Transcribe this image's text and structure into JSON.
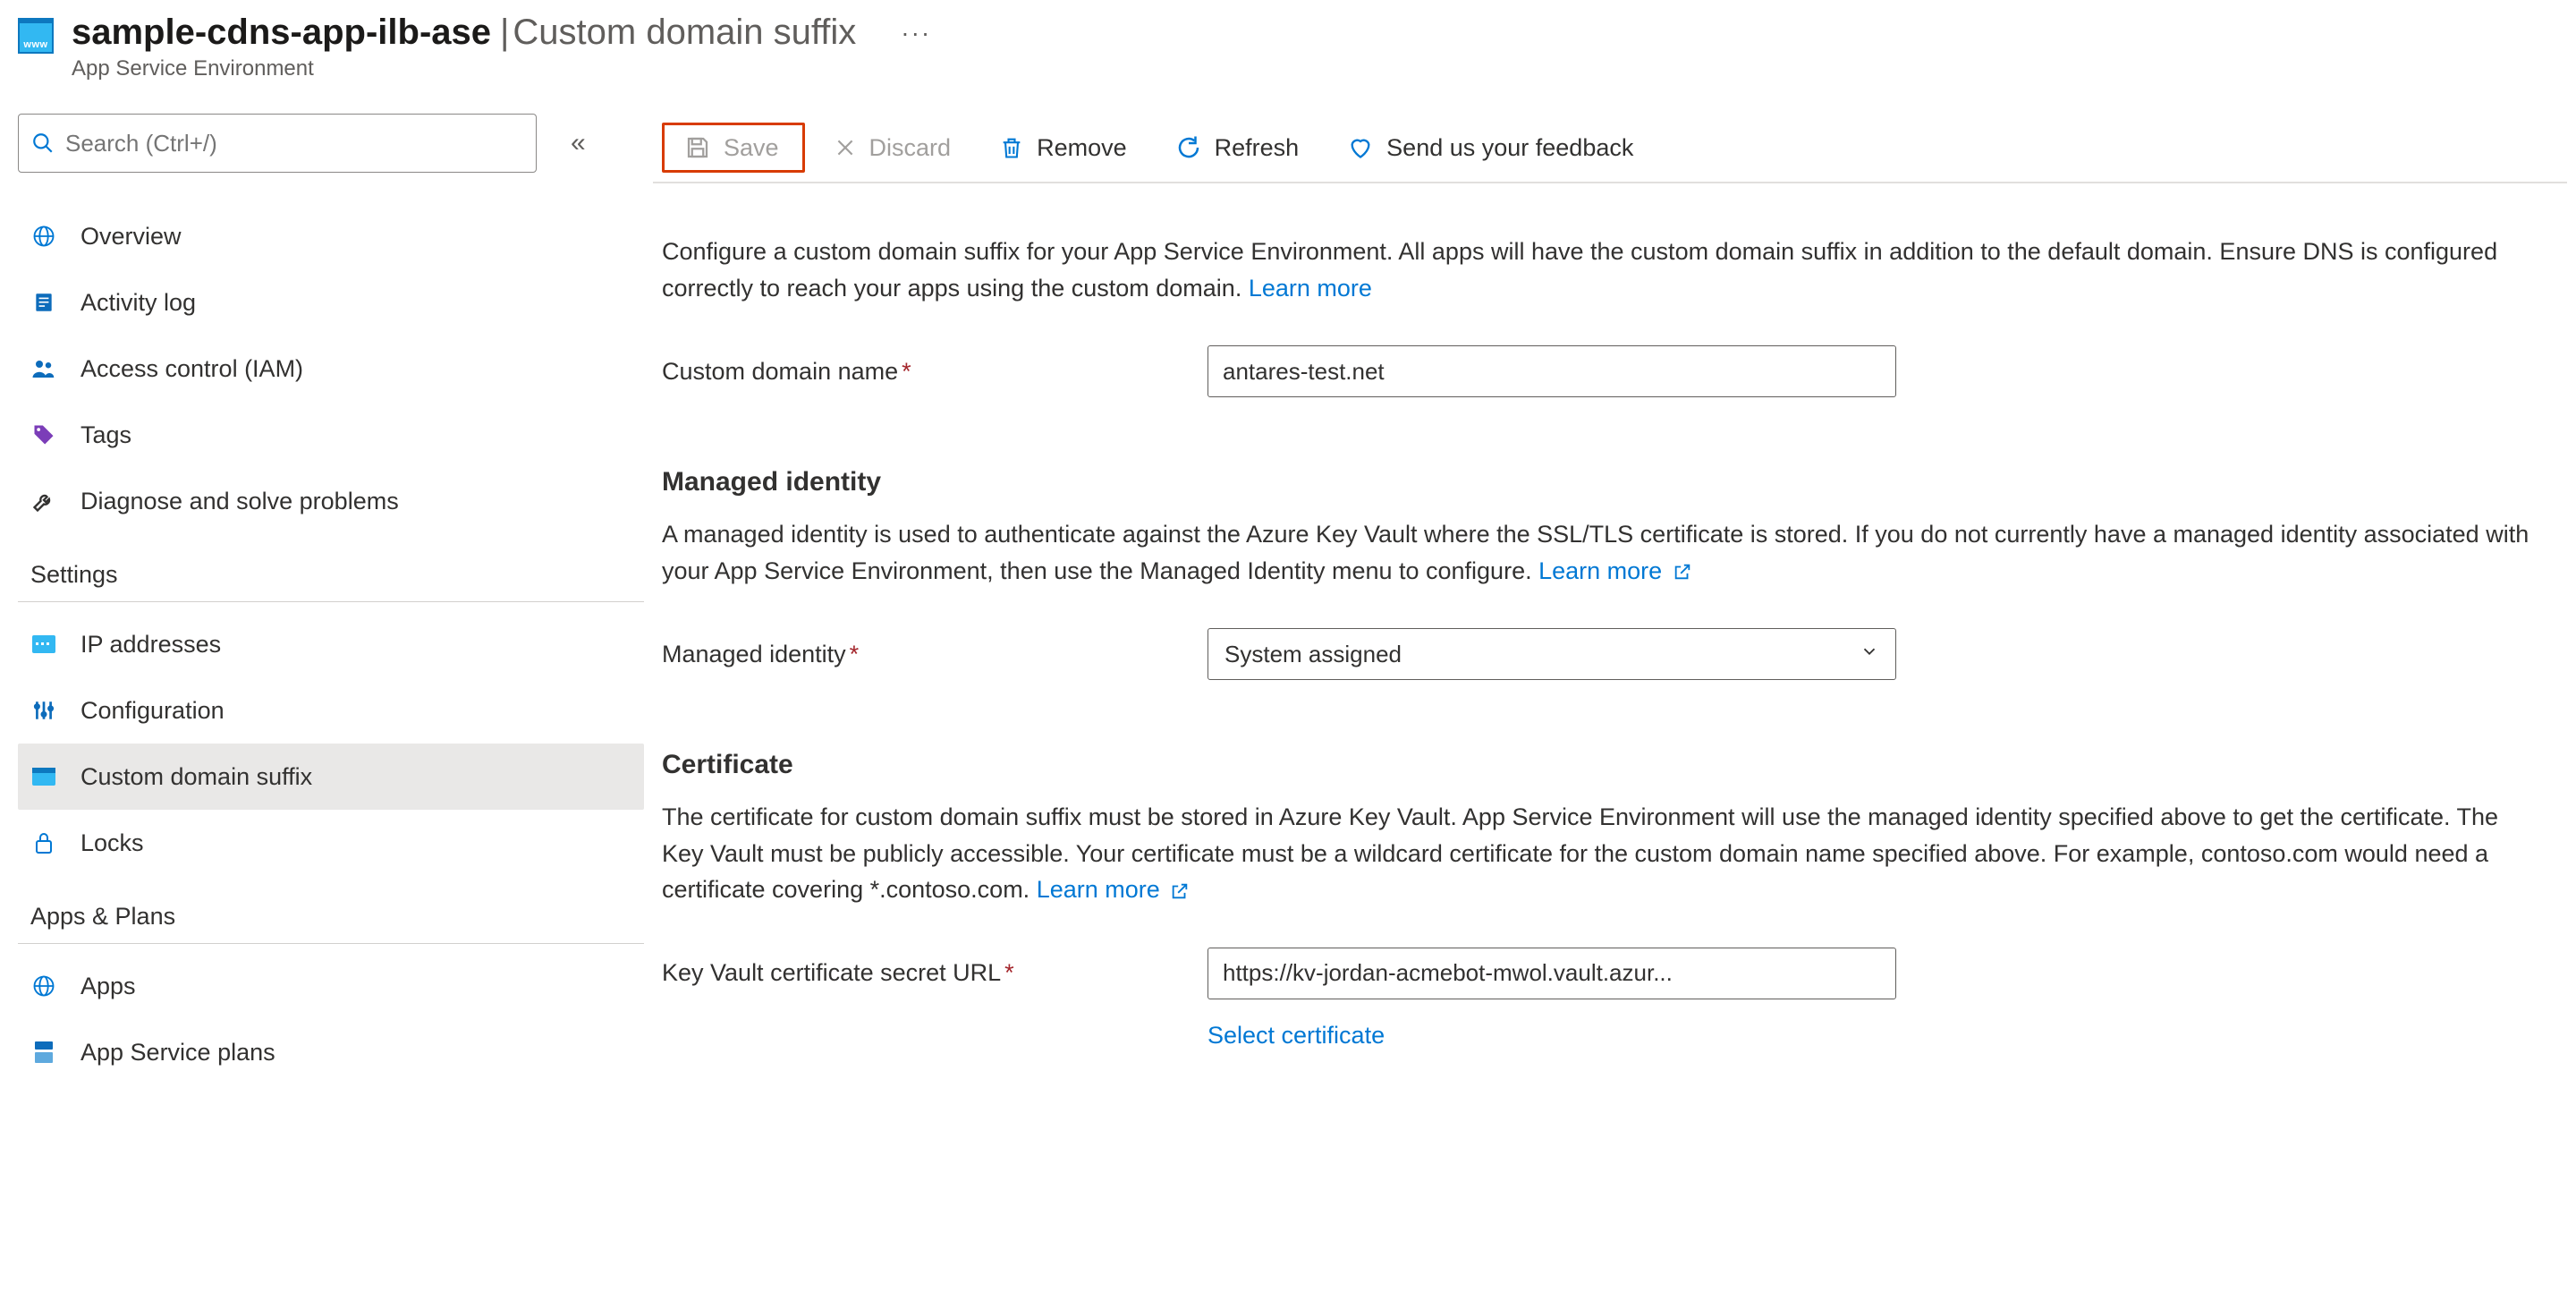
{
  "header": {
    "icon_label": "www",
    "title": "sample-cdns-app-ilb-ase",
    "subtitle": "Custom domain suffix",
    "caption": "App Service Environment",
    "more": "···"
  },
  "sidebar": {
    "search_placeholder": "Search (Ctrl+/)",
    "collapse": "«",
    "nav_main": [
      {
        "label": "Overview"
      },
      {
        "label": "Activity log"
      },
      {
        "label": "Access control (IAM)"
      },
      {
        "label": "Tags"
      },
      {
        "label": "Diagnose and solve problems"
      }
    ],
    "group_settings": "Settings",
    "nav_settings": [
      {
        "label": "IP addresses"
      },
      {
        "label": "Configuration"
      },
      {
        "label": "Custom domain suffix"
      },
      {
        "label": "Locks"
      }
    ],
    "group_apps": "Apps & Plans",
    "nav_apps": [
      {
        "label": "Apps"
      },
      {
        "label": "App Service plans"
      }
    ]
  },
  "toolbar": {
    "save": "Save",
    "discard": "Discard",
    "remove": "Remove",
    "refresh": "Refresh",
    "feedback": "Send us your feedback"
  },
  "content": {
    "intro": "Configure a custom domain suffix for your App Service Environment. All apps will have the custom domain suffix in addition to the default domain. Ensure DNS is configured correctly to reach your apps using the custom domain. ",
    "learn_more": "Learn more",
    "custom_domain_label": "Custom domain name",
    "custom_domain_value": "antares-test.net",
    "managed_identity_title": "Managed identity",
    "managed_identity_desc": "A managed identity is used to authenticate against the Azure Key Vault where the SSL/TLS certificate is stored. If you do not currently have a managed identity associated with your App Service Environment, then use the Managed Identity menu to configure. ",
    "managed_identity_label": "Managed identity",
    "managed_identity_value": "System assigned",
    "certificate_title": "Certificate",
    "certificate_desc": "The certificate for custom domain suffix must be stored in Azure Key Vault. App Service Environment will use the managed identity specified above to get the certificate. The Key Vault must be publicly accessible. Your certificate must be a wildcard certificate for the custom domain name specified above. For example, contoso.com would need a certificate covering *.contoso.com. ",
    "keyvault_label": "Key Vault certificate secret URL",
    "keyvault_value": "https://kv-jordan-acmebot-mwol.vault.azur...",
    "select_certificate": "Select certificate"
  }
}
